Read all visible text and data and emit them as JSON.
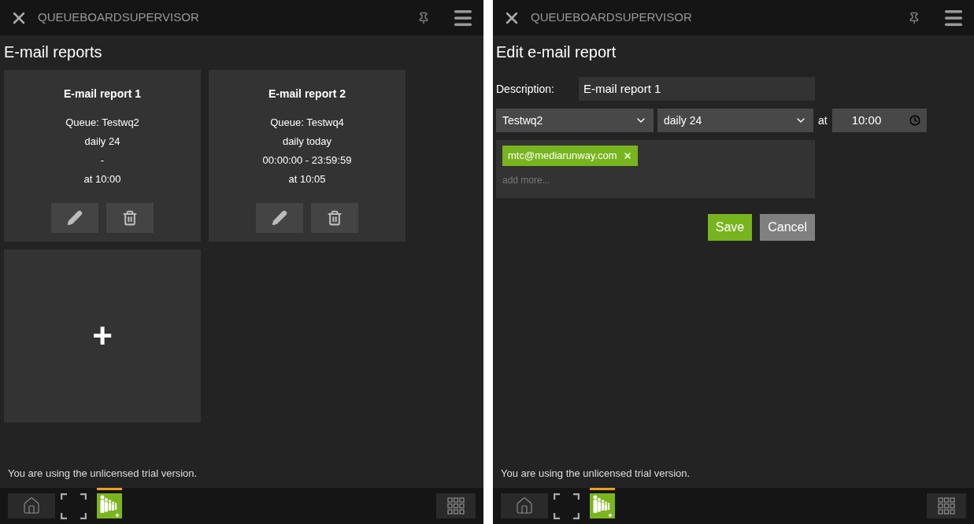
{
  "panels": [
    {
      "kind": "list",
      "header": {
        "title": "QUEUEBOARDSUPERVISOR"
      },
      "heading": "E-mail reports",
      "reports": [
        {
          "title": "E-mail report 1",
          "lines": [
            "Queue: Testwq2",
            "daily 24",
            "-",
            "at 10:00"
          ]
        },
        {
          "title": "E-mail report 2",
          "lines": [
            "Queue: Testwq4",
            "daily today",
            "00:00:00 - 23:59:59",
            "at 10:05"
          ]
        }
      ],
      "add_card": {
        "symbol": "+"
      },
      "notice": "You are using the unlicensed trial version.",
      "taskbar": {
        "app_selected": true
      }
    },
    {
      "kind": "edit",
      "header": {
        "title": "QUEUEBOARDSUPERVISOR"
      },
      "heading": "Edit e-mail report",
      "form": {
        "description_label": "Description:",
        "description_value": "E-mail report 1",
        "queue": "Testwq2",
        "schedule": "daily 24",
        "at_label": "at",
        "time": "10:00",
        "recipients": [
          {
            "label": "mtc@mediarunway.com"
          }
        ],
        "recipients_placeholder": "add more...",
        "save": "Save",
        "cancel": "Cancel"
      },
      "notice": "You are using the unlicensed trial version.",
      "taskbar": {
        "app_selected": true
      }
    }
  ]
}
